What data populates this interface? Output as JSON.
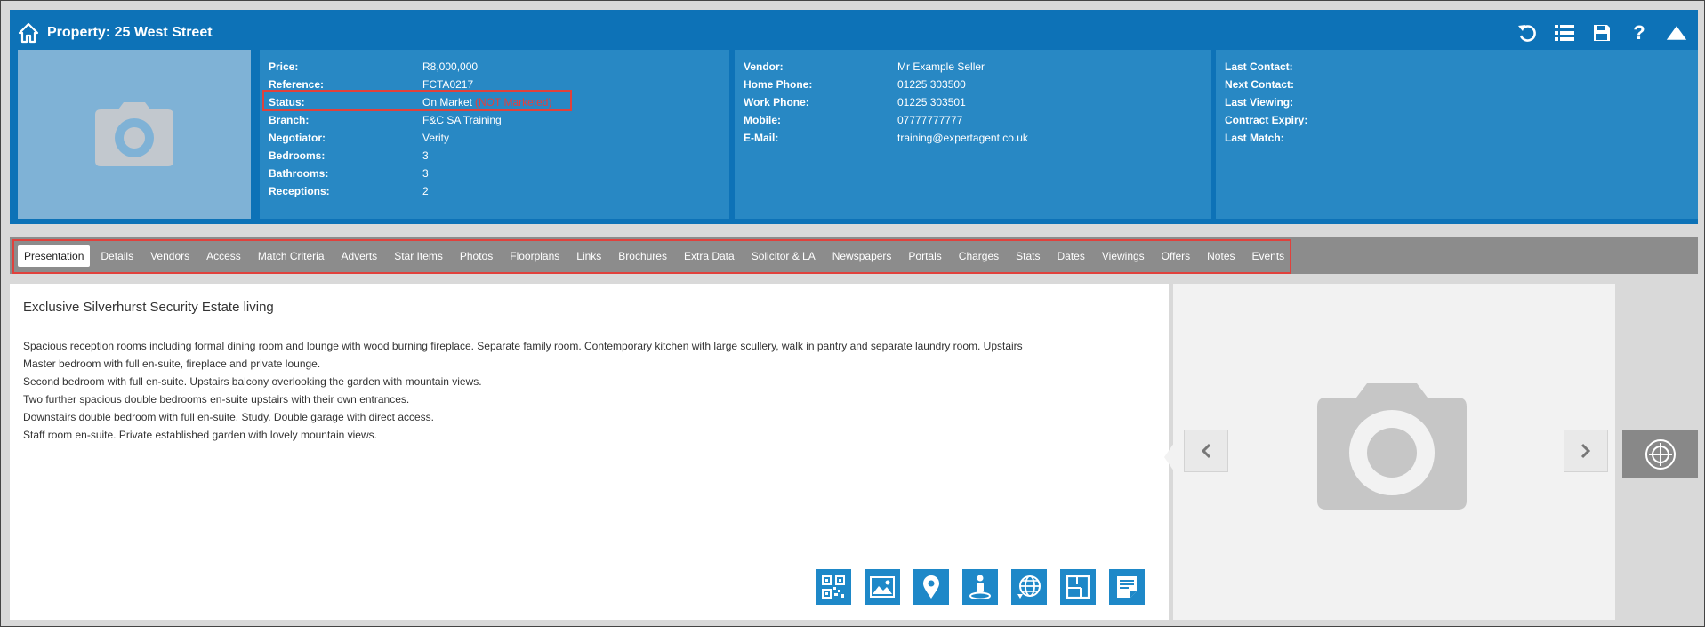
{
  "header": {
    "title": "Property: 25 West Street",
    "home_icon": "house-icon",
    "tools": [
      "undo-icon",
      "list-icon",
      "save-icon",
      "help-icon",
      "collapse-up-icon"
    ],
    "help_glyph": "?"
  },
  "property": {
    "rows": [
      {
        "label": "Price:",
        "value": "R8,000,000"
      },
      {
        "label": "Reference:",
        "value": "FCTA0217"
      },
      {
        "label": "Status:",
        "value": "On Market",
        "extra": "(NOT Marketed)"
      },
      {
        "label": "Branch:",
        "value": "F&C SA Training"
      },
      {
        "label": "Negotiator:",
        "value": "Verity"
      },
      {
        "label": "Bedrooms:",
        "value": "3"
      },
      {
        "label": "Bathrooms:",
        "value": "3"
      },
      {
        "label": "Receptions:",
        "value": "2"
      }
    ]
  },
  "vendor": {
    "rows": [
      {
        "label": "Vendor:",
        "value": "Mr Example Seller"
      },
      {
        "label": "Home Phone:",
        "value": "01225 303500"
      },
      {
        "label": "Work Phone:",
        "value": "01225 303501"
      },
      {
        "label": "Mobile:",
        "value": "07777777777"
      },
      {
        "label": "E-Mail:",
        "value": "training@expertagent.co.uk"
      }
    ]
  },
  "contact": {
    "rows": [
      {
        "label": "Last Contact:",
        "value": ""
      },
      {
        "label": "Next Contact:",
        "value": ""
      },
      {
        "label": "Last Viewing:",
        "value": ""
      },
      {
        "label": "Contract Expiry:",
        "value": ""
      },
      {
        "label": "Last Match:",
        "value": ""
      }
    ]
  },
  "tabs": [
    "Presentation",
    "Details",
    "Vendors",
    "Access",
    "Match Criteria",
    "Adverts",
    "Star Items",
    "Photos",
    "Floorplans",
    "Links",
    "Brochures",
    "Extra Data",
    "Solicitor & LA",
    "Newspapers",
    "Portals",
    "Charges",
    "Stats",
    "Dates",
    "Viewings",
    "Offers",
    "Notes",
    "Events"
  ],
  "active_tab": "Presentation",
  "presentation": {
    "heading": "Exclusive Silverhurst Security Estate living",
    "lines": [
      "Spacious reception rooms including formal dining room and lounge with wood burning fireplace.  Separate family room.  Contemporary kitchen with large scullery, walk in pantry and separate laundry room.  Upstairs",
      "Master bedroom with full en-suite, fireplace and private  lounge.",
      "Second bedroom with full en-suite.  Upstairs balcony overlooking the garden with mountain views.",
      "Two further spacious double bedrooms en-suite upstairs with their own entrances.",
      "Downstairs double bedroom with full en-suite.  Study.  Double garage with direct access.",
      "Staff room en-suite.  Private established garden with lovely mountain views."
    ],
    "action_icons": [
      "qr-code-icon",
      "image-icon",
      "map-pin-icon",
      "street-view-icon",
      "globe-icon",
      "floorplan-icon",
      "brochure-icon"
    ]
  },
  "gallery": {
    "placeholder_icon": "camera-icon",
    "prev_icon": "chevron-left-icon",
    "next_icon": "chevron-right-icon",
    "zoom_icon": "crosshair-icon"
  },
  "colors": {
    "header_bg": "#0d72b7",
    "panel_bg": "#2888c4",
    "status_warning": "#e04040",
    "highlight_border": "#e0413c",
    "tab_bar": "#8c8c8c",
    "action_icon_bg": "#1e88c8"
  }
}
